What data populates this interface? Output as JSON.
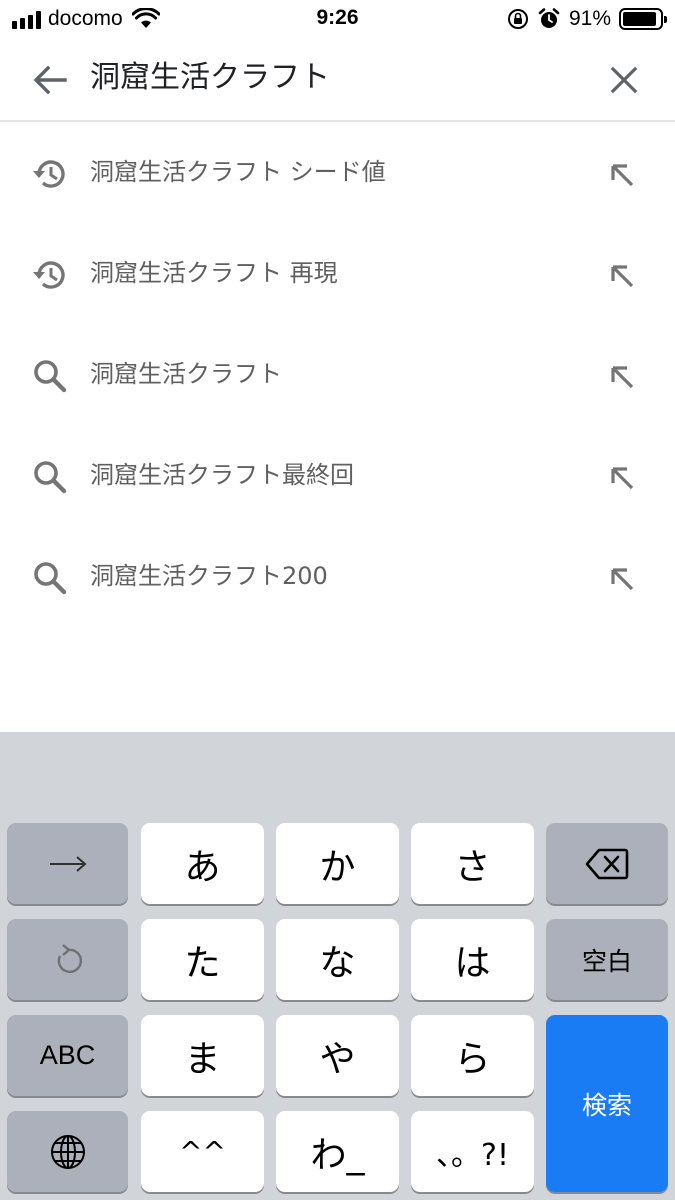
{
  "status_bar": {
    "carrier": "docomo",
    "time": "9:26",
    "battery": "91%",
    "battery_level": 0.91,
    "icons": [
      "signal-bars",
      "wifi-icon",
      "rotation-lock-icon",
      "alarm-icon",
      "battery-icon"
    ]
  },
  "search": {
    "query": "洞窟生活クラフト",
    "back_icon": "arrow-left",
    "clear_icon": "close-x"
  },
  "suggestions": [
    {
      "text": "洞窟生活クラフト シード値",
      "icon": "history-icon"
    },
    {
      "text": "洞窟生活クラフト 再現",
      "icon": "history-icon"
    },
    {
      "text": "洞窟生活クラフト",
      "icon": "search-icon"
    },
    {
      "text": "洞窟生活クラフト最終回",
      "icon": "search-icon"
    },
    {
      "text": "洞窟生活クラフト200",
      "icon": "search-icon"
    }
  ],
  "keyboard": {
    "row1": [
      "→",
      "あ",
      "か",
      "さ",
      "⌫"
    ],
    "row2": [
      "↺",
      "た",
      "な",
      "は",
      "空白"
    ],
    "row3": [
      "ABC",
      "ま",
      "や",
      "ら"
    ],
    "row4": [
      "🌐",
      "^^",
      "わ_",
      "、。?!"
    ],
    "space_label": "空白",
    "abc_label": "ABC",
    "search_label": "検索"
  },
  "colors": {
    "keyboard_bg": "#d1d4d9",
    "key_light": "#ffffff",
    "key_dark": "#abb0ba",
    "key_blue": "#1a7cf5",
    "suggestion_text": "#606060",
    "icon_gray": "#757575"
  }
}
